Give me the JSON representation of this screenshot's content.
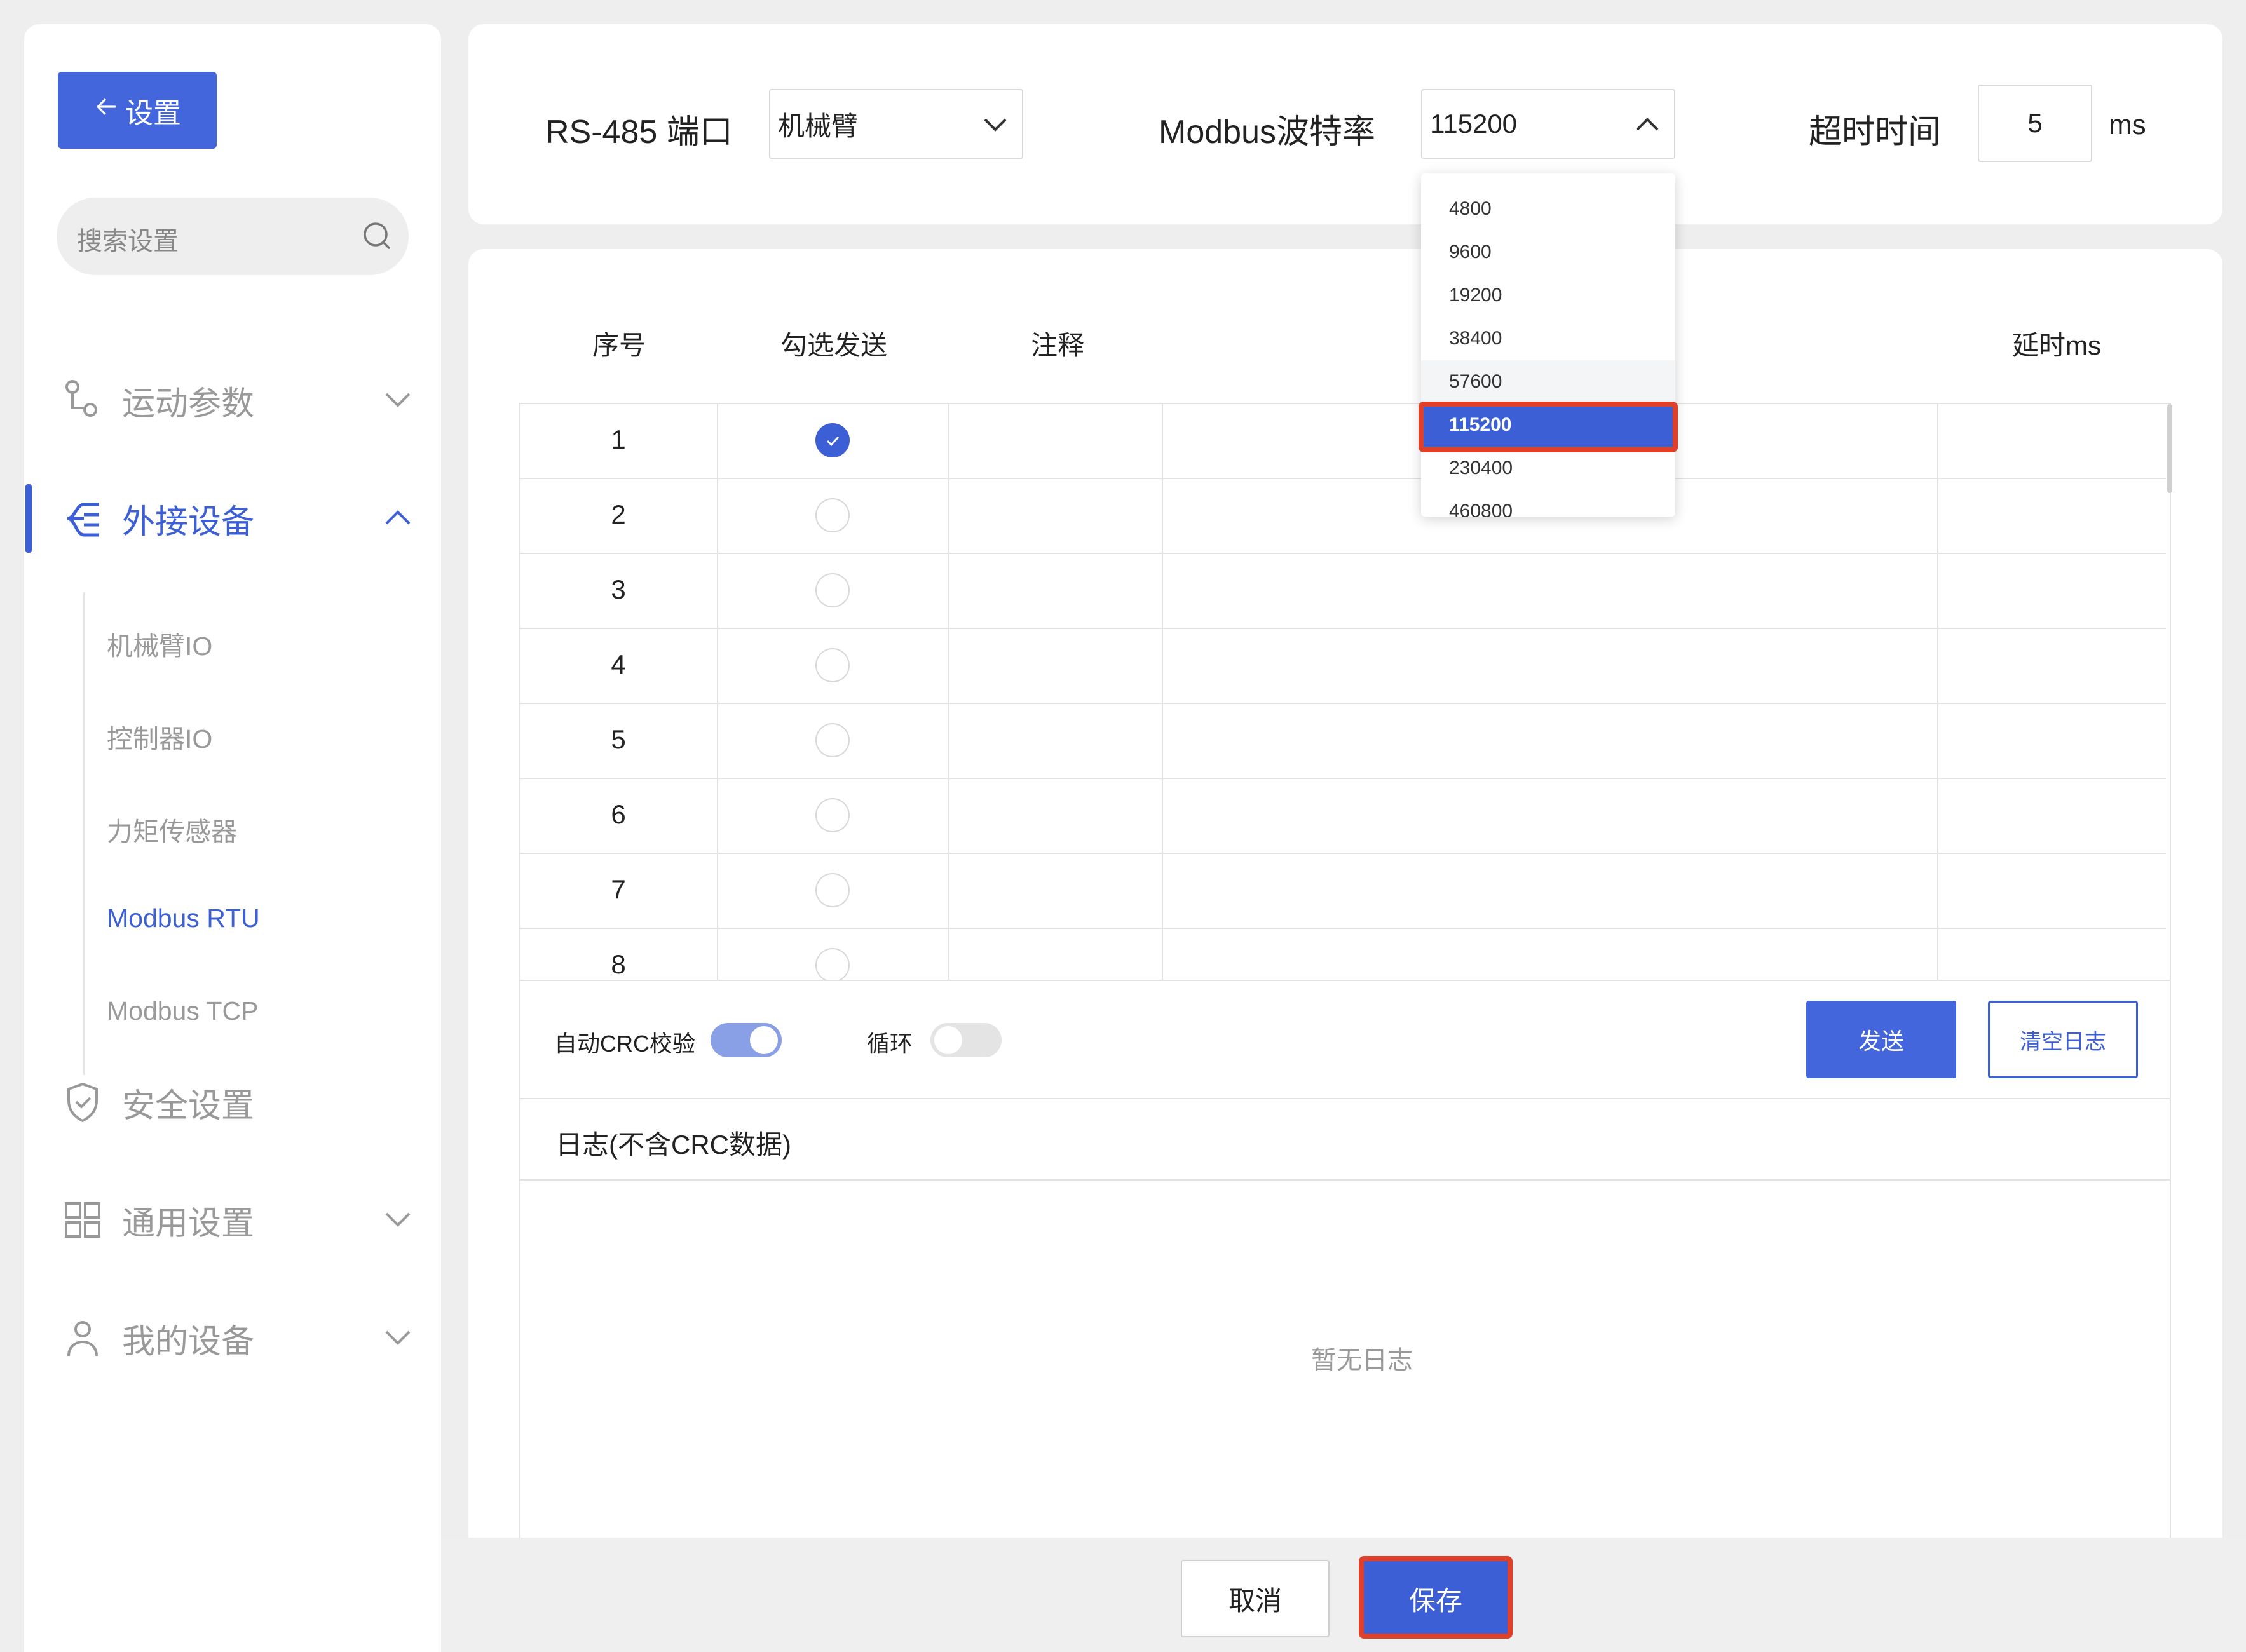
{
  "sidebar": {
    "back_label": "设置",
    "search_placeholder": "搜索设置",
    "nav": [
      {
        "label": "运动参数"
      },
      {
        "label": "外接设备"
      },
      {
        "label": "安全设置"
      },
      {
        "label": "通用设置"
      },
      {
        "label": "我的设备"
      }
    ],
    "sub_items": [
      {
        "label": "机械臂IO"
      },
      {
        "label": "控制器IO"
      },
      {
        "label": "力矩传感器"
      },
      {
        "label": "Modbus RTU"
      },
      {
        "label": "Modbus TCP"
      }
    ]
  },
  "config": {
    "port_label": "RS-485 端口",
    "port_value": "机械臂",
    "baud_label": "Modbus波特率",
    "baud_value": "115200",
    "timeout_label": "超时时间",
    "timeout_value": "5",
    "timeout_unit": "ms"
  },
  "baud_options": [
    "4800",
    "9600",
    "19200",
    "38400",
    "57600",
    "115200",
    "230400",
    "460800"
  ],
  "table": {
    "headers": {
      "index": "序号",
      "check": "勾选发送",
      "note": "注释",
      "delay": "延时ms"
    },
    "rows": [
      {
        "index": "1",
        "checked": true
      },
      {
        "index": "2",
        "checked": false
      },
      {
        "index": "3",
        "checked": false
      },
      {
        "index": "4",
        "checked": false
      },
      {
        "index": "5",
        "checked": false
      },
      {
        "index": "6",
        "checked": false
      },
      {
        "index": "7",
        "checked": false
      },
      {
        "index": "8",
        "checked": false
      }
    ]
  },
  "controls": {
    "auto_crc_label": "自动CRC校验",
    "auto_crc_on": true,
    "loop_label": "循环",
    "loop_on": false,
    "send_label": "发送",
    "clear_label": "清空日志"
  },
  "log": {
    "title": "日志(不含CRC数据)",
    "empty": "暂无日志"
  },
  "footer": {
    "cancel_label": "取消",
    "save_label": "保存"
  },
  "colors": {
    "accent": "#3d5fd6",
    "highlight": "#e0402a"
  }
}
